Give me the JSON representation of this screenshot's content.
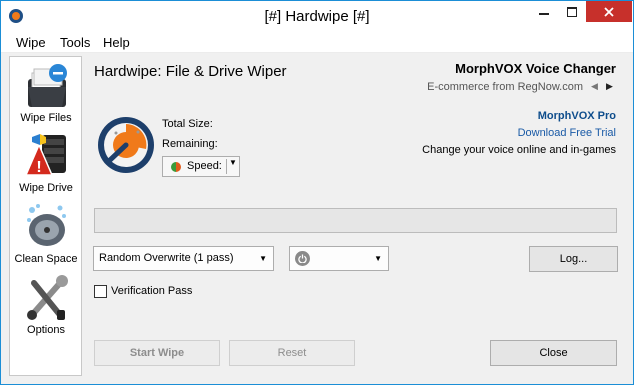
{
  "window": {
    "title": "[#] Hardwipe [#]"
  },
  "menu": {
    "items": [
      "Wipe",
      "Tools",
      "Help"
    ]
  },
  "sidebar": {
    "items": [
      {
        "label": "Wipe Files",
        "icon": "wipe-files-icon"
      },
      {
        "label": "Wipe Drive",
        "icon": "wipe-drive-icon"
      },
      {
        "label": "Clean Space",
        "icon": "clean-space-icon"
      },
      {
        "label": "Options",
        "icon": "options-icon"
      }
    ]
  },
  "main": {
    "heading": "Hardwipe: File & Drive Wiper",
    "total_size_label": "Total Size:",
    "remaining_label": "Remaining:",
    "speed_label": "Speed:",
    "wipe_method": "Random Overwrite (1 pass)",
    "log_button": "Log...",
    "verification_label": "Verification Pass",
    "verification_checked": false,
    "start_button": "Start Wipe",
    "reset_button": "Reset",
    "close_button": "Close"
  },
  "ad": {
    "title": "MorphVOX Voice Changer",
    "subtitle": "E-commerce from RegNow.com",
    "product": "MorphVOX Pro",
    "link": "Download Free Trial",
    "description": "Change your voice online and in-games"
  },
  "colors": {
    "accent": "#1b8ed6",
    "close_button": "#c7302b",
    "link": "#1a5aa6"
  }
}
